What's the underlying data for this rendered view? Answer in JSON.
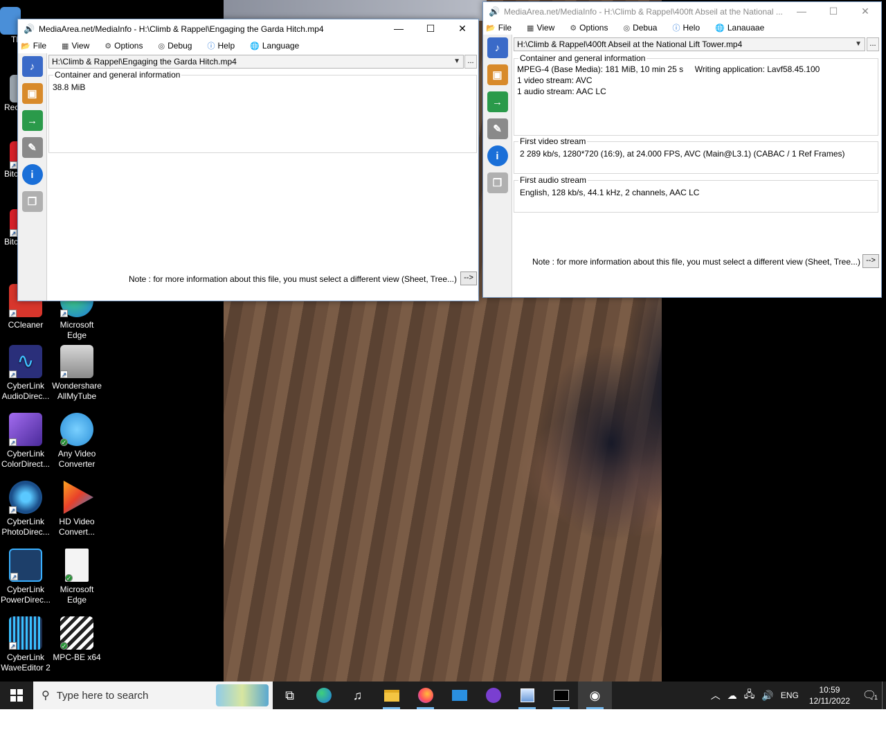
{
  "desktop": {
    "icons_partial": [
      {
        "label": "Th",
        "icon": "partial-icon"
      },
      {
        "label": "Rec",
        "icon": "recycle-bin-icon"
      },
      {
        "label": "Bitc",
        "icon": "bitcoin-app-icon"
      },
      {
        "label": "Bitc",
        "icon": "bitcoin-app-icon"
      }
    ],
    "icons": [
      {
        "id": "ccleaner",
        "label": "CCleaner",
        "icon": "ccleaner-icon",
        "color": "#d8362c"
      },
      {
        "id": "edge1",
        "label": "Microsoft Edge",
        "icon": "edge-icon",
        "color": "#1f7ae0"
      },
      {
        "id": "audiodirector",
        "label": "CyberLink AudioDirec...",
        "icon": "audiodirector-icon",
        "color": "#2a2f7a"
      },
      {
        "id": "allmytube",
        "label": "Wondershare AllMyTube",
        "icon": "allmytube-icon",
        "color": "#c8c8c8"
      },
      {
        "id": "colordirector",
        "label": "CyberLink ColorDirect...",
        "icon": "colordirector-icon",
        "color": "#6a3fc0"
      },
      {
        "id": "anyvideo",
        "label": "Any Video Converter",
        "icon": "any-video-converter-icon",
        "color": "#2b8fd8"
      },
      {
        "id": "photodirector",
        "label": "CyberLink PhotoDirec...",
        "icon": "photodirector-icon",
        "color": "#1b4f8a"
      },
      {
        "id": "hdvideo",
        "label": "HD Video Convert...",
        "icon": "hd-video-converter-icon",
        "color": "#e85a2a"
      },
      {
        "id": "powerdirector",
        "label": "CyberLink PowerDirec...",
        "icon": "powerdirector-icon",
        "color": "#1d3f6a"
      },
      {
        "id": "edge2",
        "label": "Microsoft Edge",
        "icon": "blank-document-icon",
        "color": "#f4f4f4"
      },
      {
        "id": "waveeditor",
        "label": "CyberLink WaveEditor 2",
        "icon": "waveeditor-icon",
        "color": "#1b2b4a"
      },
      {
        "id": "mpcbe",
        "label": "MPC-BE x64",
        "icon": "mpc-be-icon",
        "color": "#2a2a2a"
      }
    ]
  },
  "window1": {
    "title": "MediaArea.net/MediaInfo - H:\\Climb & Rappel\\Engaging the Garda Hitch.mp4",
    "menu": [
      "File",
      "View",
      "Options",
      "Debug",
      "Help",
      "Language"
    ],
    "file": "H:\\Climb & Rappel\\Engaging the Garda Hitch.mp4",
    "more": "...",
    "group_title": "Container and general information",
    "group_text": "38.8 MiB",
    "note": "Note : for more information about this file, you must select a different view (Sheet, Tree...)",
    "arrow": "-->"
  },
  "window2": {
    "title": "MediaArea.net/MediaInfo - H:\\Climb & Rappel\\400ft Abseil at the National ...",
    "menu": [
      "File",
      "View",
      "Options",
      "Debua",
      "Helo",
      "Lanauaae"
    ],
    "file": "H:\\Climb & Rappel\\400ft Abseil at the National Lift Tower.mp4",
    "more": "...",
    "general_title": "Container and general information",
    "general_text": "MPEG-4 (Base Media): 181 MiB, 10 min 25 s     Writing application: Lavf58.45.100\n1 video stream: AVC\n1 audio stream: AAC LC",
    "video_title": "First video stream",
    "video_text": "2 289 kb/s, 1280*720 (16:9), at 24.000 FPS, AVC (Main@L3.1) (CABAC / 1 Ref Frames)",
    "audio_title": "First audio stream",
    "audio_text": "English, 128 kb/s, 44.1 kHz, 2 channels, AAC LC",
    "note": "Note : for more information about this file, you must select a different view (Sheet, Tree...)",
    "arrow": "-->"
  },
  "window_controls": {
    "minimize": "—",
    "maximize": "☐",
    "close": "✕"
  },
  "taskbar": {
    "search_placeholder": "Type here to search",
    "apps": [
      "task-view-icon",
      "edge-icon",
      "music-icon",
      "file-explorer-icon",
      "firefox-icon",
      "mail-icon",
      "media-app-icon",
      "image-viewer-icon",
      "terminal-icon",
      "mediainfo-icon"
    ],
    "language": "ENG",
    "time": "10:59",
    "date": "12/11/2022",
    "notifications": "1"
  }
}
